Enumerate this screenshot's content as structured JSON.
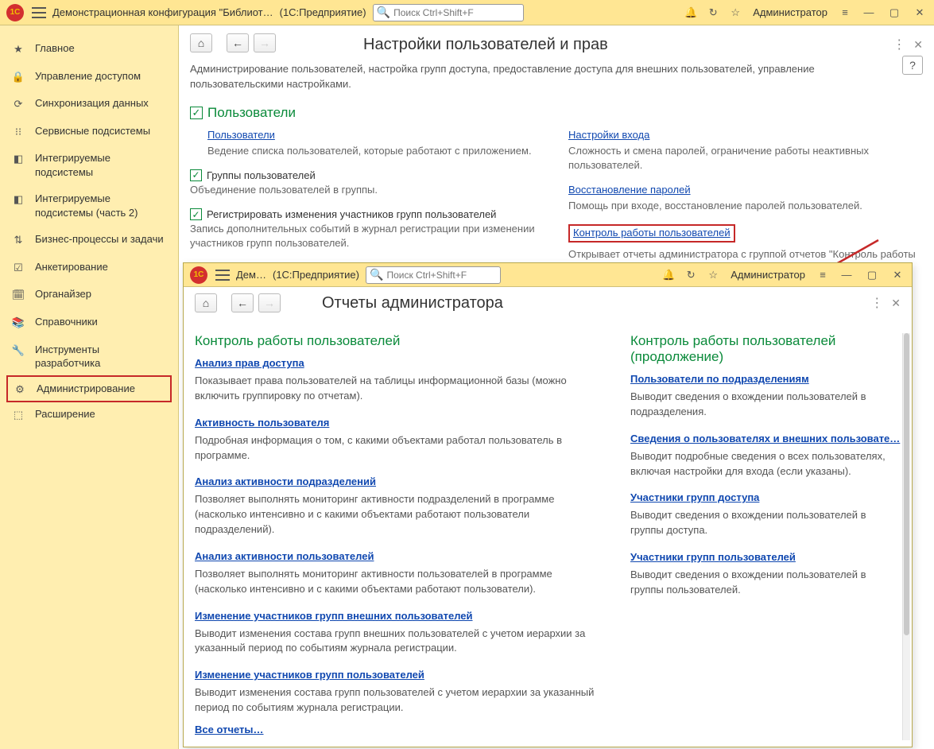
{
  "topbar": {
    "app_title": "Демонстрационная конфигурация \"Библиот…",
    "platform": "(1С:Предприятие)",
    "search_placeholder": "Поиск Ctrl+Shift+F",
    "user": "Администратор"
  },
  "sidebar": {
    "items": [
      {
        "icon": "★",
        "label": "Главное"
      },
      {
        "icon": "🔒",
        "label": "Управление доступом"
      },
      {
        "icon": "⟳",
        "label": "Синхронизация данных"
      },
      {
        "icon": "⁝⁝",
        "label": "Сервисные подсистемы"
      },
      {
        "icon": "◧",
        "label": "Интегрируемые подсистемы"
      },
      {
        "icon": "◧",
        "label": "Интегрируемые подсистемы (часть 2)"
      },
      {
        "icon": "⇅",
        "label": "Бизнес-процессы и задачи"
      },
      {
        "icon": "☑",
        "label": "Анкетирование"
      },
      {
        "icon": "🗓",
        "label": "Органайзер"
      },
      {
        "icon": "📚",
        "label": "Справочники"
      },
      {
        "icon": "🔧",
        "label": "Инструменты разработчика"
      },
      {
        "icon": "⚙",
        "label": "Администрирование",
        "selected": true
      },
      {
        "icon": "⬚",
        "label": "Расширение"
      }
    ]
  },
  "page": {
    "title": "Настройки пользователей и прав",
    "subtitle": "Администрирование пользователей, настройка групп доступа, предоставление доступа для внешних пользователей, управление пользовательскими настройками.",
    "section_title": "Пользователи",
    "left": {
      "users_link": "Пользователи",
      "users_desc": "Ведение списка пользователей, которые работают с приложением.",
      "groups_cb_label": "Группы пользователей",
      "groups_desc": "Объединение пользователей в группы.",
      "reg_cb_label": "Регистрировать изменения участников групп пользователей",
      "reg_desc": "Запись дополнительных событий в журнал регистрации при изменении участников групп пользователей."
    },
    "right": {
      "login_link": "Настройки входа",
      "login_desc": "Сложность и смена паролей, ограничение работы неактивных пользователей.",
      "recov_link": "Восстановление паролей",
      "recov_desc": "Помощь при входе, восстановление паролей пользователей.",
      "control_link": "Контроль работы пользователей",
      "control_desc": "Открывает отчеты администратора с группой отчетов \"Контроль работы пользователей\" для анализа работы, настроек и прав"
    }
  },
  "inner": {
    "app_title": "Дем…",
    "platform": "(1С:Предприятие)",
    "search_placeholder": "Поиск Ctrl+Shift+F",
    "user": "Администратор",
    "page_title": "Отчеты администратора",
    "section_left": "Контроль работы пользователей",
    "section_right": "Контроль работы пользователей (продолжение)",
    "left_items": [
      {
        "link": "Анализ прав доступа",
        "desc": "Показывает права пользователей на таблицы информационной базы (можно включить группировку по отчетам)."
      },
      {
        "link": "Активность пользователя",
        "desc": "Подробная информация о том, с какими объектами работал пользователь в программе."
      },
      {
        "link": "Анализ активности подразделений",
        "desc": "Позволяет выполнять мониторинг активности подразделений в программе (насколько интенсивно и с какими объектами работают пользователи подразделений)."
      },
      {
        "link": "Анализ активности пользователей",
        "desc": "Позволяет выполнять мониторинг активности пользователей в программе (насколько интенсивно и с какими объектами работают пользователи)."
      },
      {
        "link": "Изменение участников групп внешних пользователей",
        "desc": "Выводит изменения состава групп внешних пользователей с учетом иерархии за указанный период по событиям журнала регистрации."
      },
      {
        "link": "Изменение участников групп пользователей",
        "desc": "Выводит изменения состава групп пользователей с учетом иерархии за указанный период по событиям журнала регистрации."
      }
    ],
    "right_items": [
      {
        "link": "Пользователи по подразделениям",
        "desc": "Выводит сведения о вхождении пользователей в подразделения."
      },
      {
        "link": "Сведения о пользователях и внешних пользовате…",
        "desc": "Выводит подробные сведения о всех пользователях,\nвключая настройки для входа (если указаны)."
      },
      {
        "link": "Участники групп доступа",
        "desc": "Выводит сведения о вхождении пользователей в группы доступа."
      },
      {
        "link": "Участники групп пользователей",
        "desc": "Выводит сведения о вхождении пользователей в группы пользователей."
      }
    ],
    "all_link": "Все отчеты…"
  }
}
